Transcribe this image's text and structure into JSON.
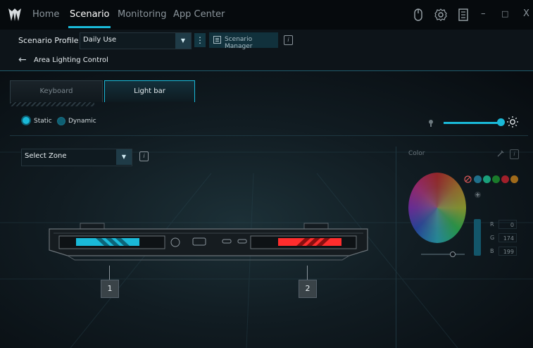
{
  "nav": {
    "tabs": [
      {
        "label": "Home"
      },
      {
        "label": "Scenario"
      },
      {
        "label": "Monitoring"
      },
      {
        "label": "App Center"
      }
    ],
    "active_tab": "Scenario",
    "window_buttons": {
      "minimize": "–",
      "maximize": "□",
      "close": "X"
    }
  },
  "profile": {
    "label": "Scenario Profile",
    "value": "Daily Use",
    "manager_label": "Scenario Manager"
  },
  "breadcrumb": {
    "back": "←",
    "title": "Area Lighting Control"
  },
  "tabs": [
    {
      "label": "Keyboard"
    },
    {
      "label": "Light bar"
    }
  ],
  "effects": {
    "static_label": "Static",
    "dynamic_label": "Dynamic",
    "selected": "Static",
    "brightness_level": 1.0
  },
  "zone": {
    "placeholder": "Select Zone",
    "zones": [
      {
        "label": "1",
        "color": "#1ab9d8"
      },
      {
        "label": "2",
        "color": "#ff3030"
      }
    ]
  },
  "color": {
    "title": "Color",
    "swatches": [
      "#1f6f8a",
      "#1aa07a",
      "#1a7a2a",
      "#a01f2a",
      "#a06a1a",
      "#6a1aa0"
    ],
    "r_label": "R",
    "r_value": "0",
    "g_label": "G",
    "g_value": "174",
    "b_label": "B",
    "b_value": "199"
  }
}
